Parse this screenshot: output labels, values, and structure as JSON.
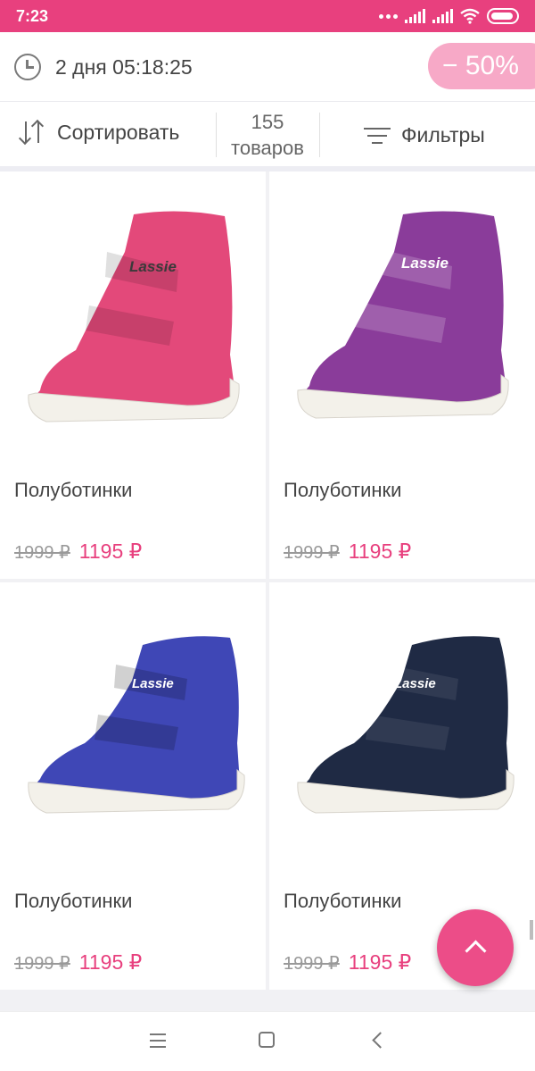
{
  "status_bar": {
    "time": "7:23",
    "icons": [
      "more-dots-icon",
      "signal-icon",
      "signal-icon",
      "wifi-icon",
      "battery-icon"
    ]
  },
  "promo": {
    "timer": "2 дня 05:18:25",
    "discount": "− 50%",
    "icon": "clock-icon"
  },
  "toolbar": {
    "sort_label": "Сортировать",
    "count_number": "155",
    "count_label": "товаров",
    "filter_label": "Фильтры"
  },
  "products": [
    {
      "name": "Полуботинки",
      "old_price": "1999 ₽",
      "price": "1195 ₽",
      "color": "#e3497a",
      "brand": "Lassie"
    },
    {
      "name": "Полуботинки",
      "old_price": "1999 ₽",
      "price": "1195 ₽",
      "color": "#8a3c9a",
      "brand": "Lassie"
    },
    {
      "name": "Полуботинки",
      "old_price": "1999 ₽",
      "price": "1195 ₽",
      "color": "#3f47b6",
      "brand": "Lassie"
    },
    {
      "name": "Полуботинки",
      "old_price": "1999 ₽",
      "price": "1195 ₽",
      "color": "#1f2a44",
      "brand": "Lassie"
    }
  ],
  "colors": {
    "accent": "#e8407e",
    "badge": "#f7a9c7",
    "price": "#e8407e"
  },
  "nav": {
    "icons": [
      "menu-icon",
      "home-icon",
      "back-icon"
    ]
  }
}
